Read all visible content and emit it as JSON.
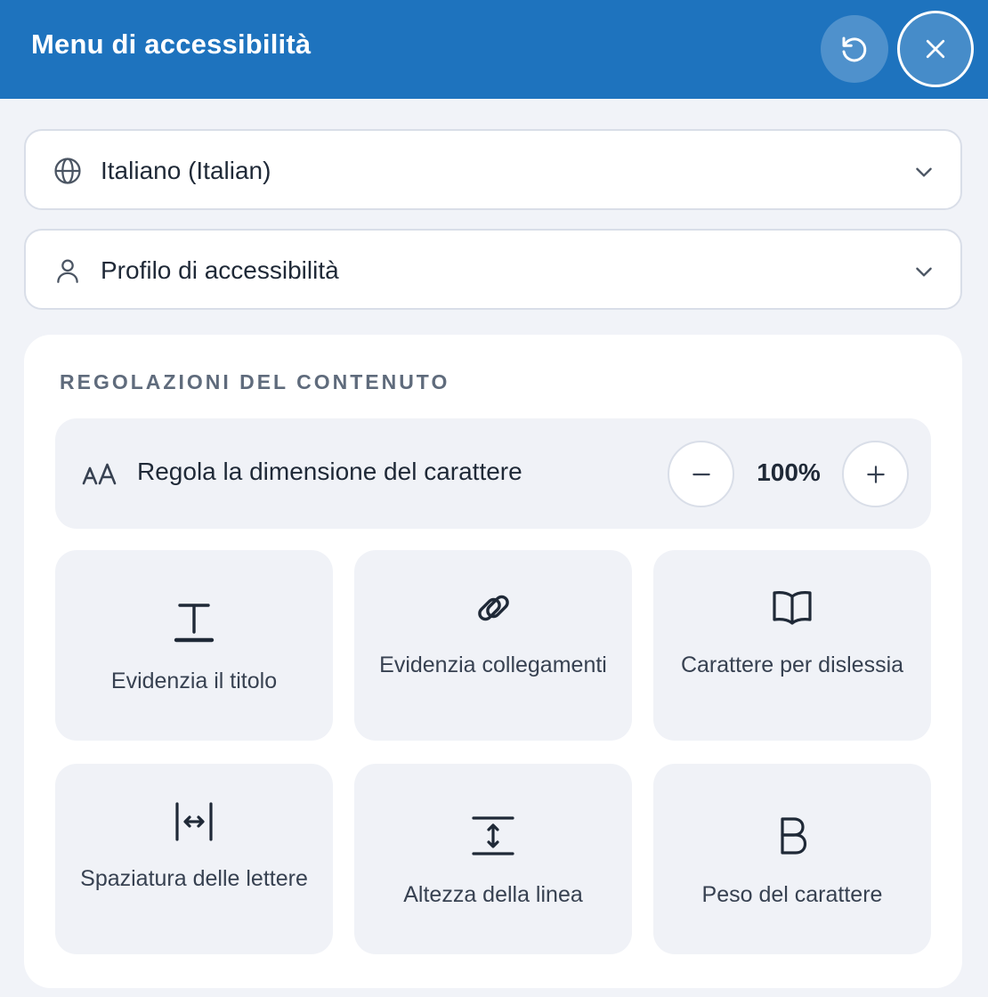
{
  "header": {
    "title": "Menu di accessibilità",
    "bg_color": "#1e73be",
    "reset_icon": "reset-icon",
    "close_icon": "close-icon"
  },
  "language_select": {
    "icon": "globe-icon",
    "value": "Italiano (Italian)"
  },
  "profile_select": {
    "icon": "user-icon",
    "value": "Profilo di accessibilità"
  },
  "content_section": {
    "title": "REGOLAZIONI DEL CONTENUTO",
    "font_size": {
      "icon": "font-size-icon",
      "label": "Regola la dimensione del carattere",
      "value": "100%",
      "decrease_icon": "minus-icon",
      "increase_icon": "plus-icon"
    },
    "tiles": [
      {
        "icon": "highlight-title-icon",
        "label": "Evidenzia il titolo"
      },
      {
        "icon": "link-icon",
        "label": "Evidenzia collegamenti"
      },
      {
        "icon": "book-icon",
        "label": "Carattere per dislessia"
      },
      {
        "icon": "letter-spacing-icon",
        "label": "Spaziatura delle lettere"
      },
      {
        "icon": "line-height-icon",
        "label": "Altezza della linea"
      },
      {
        "icon": "bold-icon",
        "label": "Peso del carattere"
      }
    ]
  }
}
